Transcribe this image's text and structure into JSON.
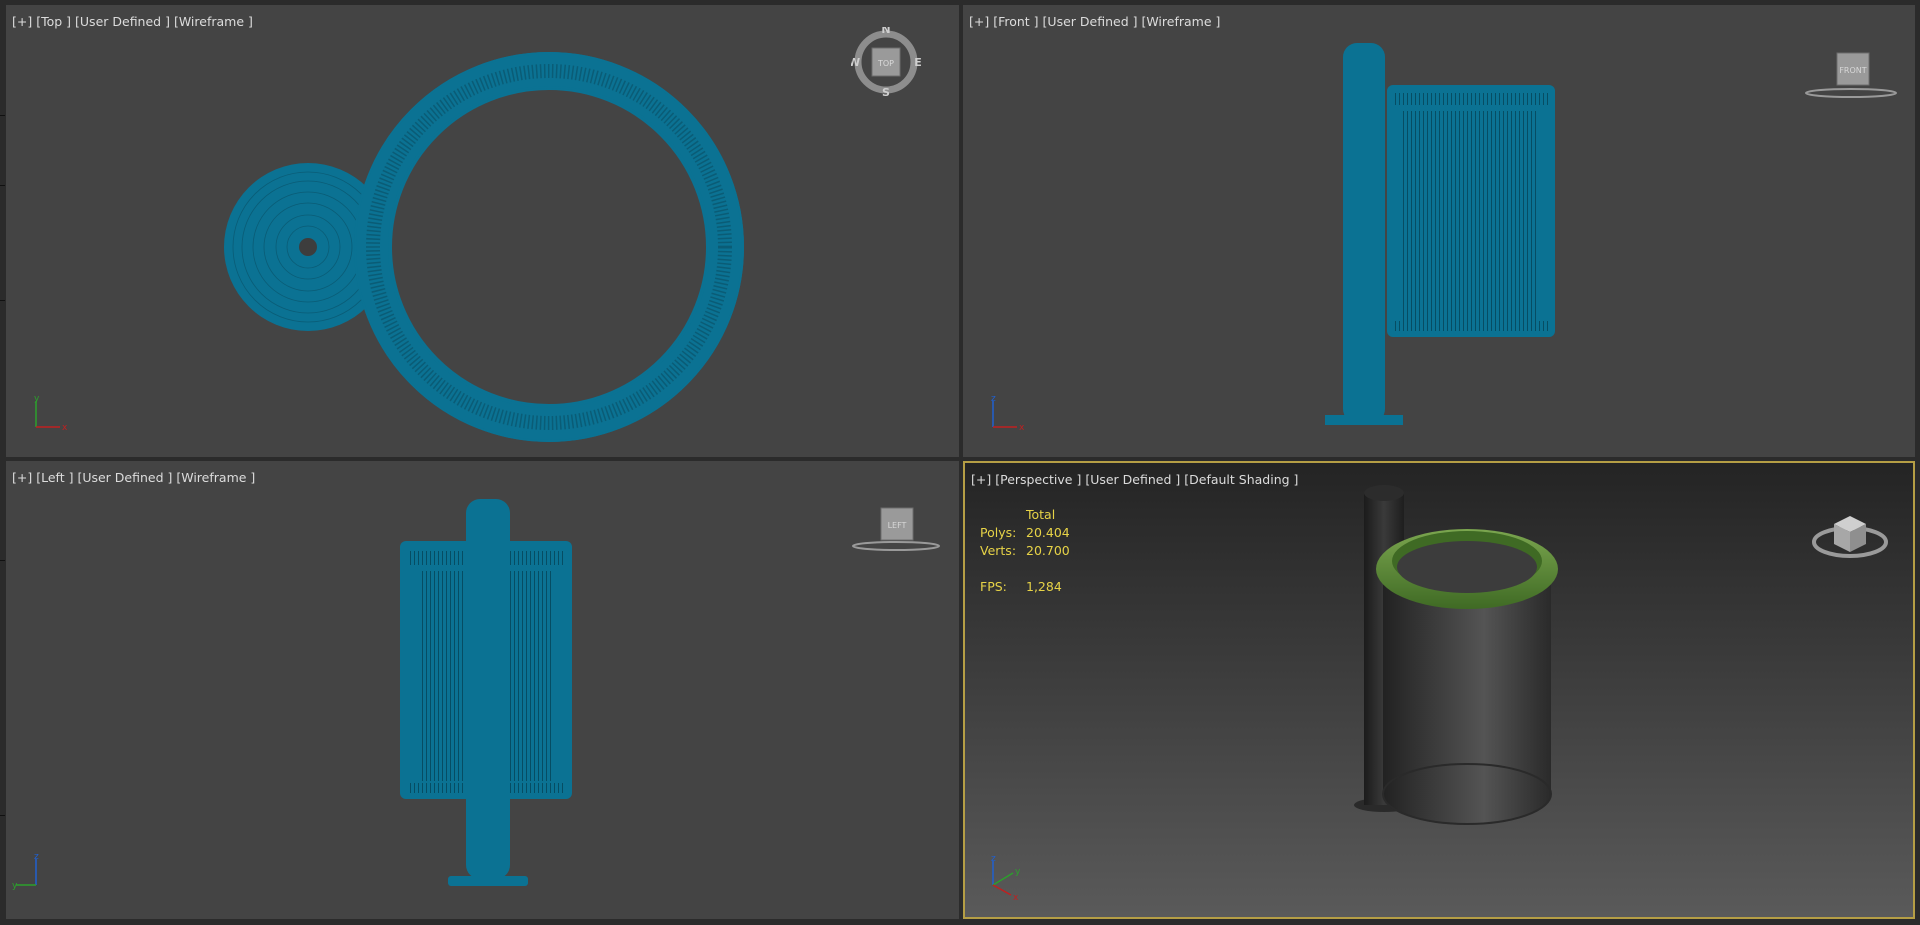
{
  "viewports": {
    "top": {
      "label": [
        "[+]",
        "[Top ]",
        "[User Defined ]",
        "[Wireframe ]"
      ],
      "compass": {
        "n": "N",
        "s": "S",
        "e": "E",
        "w": "W",
        "cube": "TOP"
      }
    },
    "front": {
      "label": [
        "[+]",
        "[Front ]",
        "[User Defined ]",
        "[Wireframe ]"
      ],
      "cube": "FRONT"
    },
    "left": {
      "label": [
        "[+]",
        "[Left ]",
        "[User Defined ]",
        "[Wireframe ]"
      ],
      "cube": "LEFT"
    },
    "perspective": {
      "label": [
        "[+]",
        "[Perspective ]",
        "[User Defined ]",
        "[Default Shading ]"
      ],
      "stats": {
        "header": "Total",
        "polys_label": "Polys:",
        "polys": "20.404",
        "verts_label": "Verts:",
        "verts": "20.700",
        "fps_label": "FPS:",
        "fps": "1,284"
      }
    }
  },
  "axes": {
    "x": "x",
    "y": "y",
    "z": "z"
  },
  "colors": {
    "wire": "#0b7293",
    "wire_dark": "#064d63",
    "viewport_bg": "#444444",
    "active_border": "#b59e45",
    "stats_text": "#e7d347",
    "rim_green": "#5b8c34"
  }
}
